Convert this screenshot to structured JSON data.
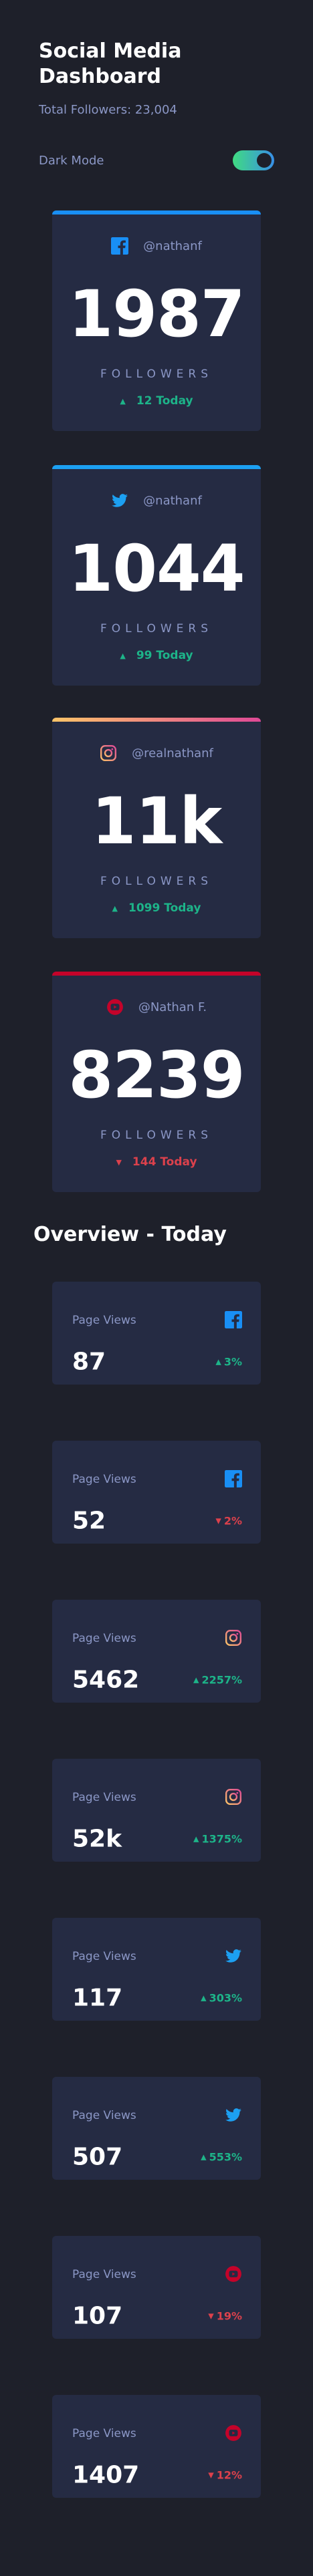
{
  "header": {
    "title": "Social Media Dashboard",
    "total_followers": "Total Followers: 23,004",
    "mode_label": "Dark Mode"
  },
  "colors": {
    "facebook": "#198ff5",
    "twitter": "#1ca0f2",
    "instagram_gradient": [
      "#fdc468",
      "#df4996"
    ],
    "youtube": "#c4032a",
    "up": "#1db489",
    "down": "#dc414c",
    "card_bg": "#252b43",
    "page_bg": "#1e202a",
    "muted_text": "#8b97c6"
  },
  "follower_cards": [
    {
      "platform": "facebook",
      "icon": "facebook-icon",
      "handle": "@nathanf",
      "count": "1987",
      "label": "FOLLOWERS",
      "today": "12 Today",
      "trend": "up"
    },
    {
      "platform": "twitter",
      "icon": "twitter-icon",
      "handle": "@nathanf",
      "count": "1044",
      "label": "FOLLOWERS",
      "today": "99 Today",
      "trend": "up"
    },
    {
      "platform": "instagram",
      "icon": "instagram-icon",
      "handle": "@realnathanf",
      "count": "11k",
      "label": "FOLLOWERS",
      "today": "1099 Today",
      "trend": "up"
    },
    {
      "platform": "youtube",
      "icon": "youtube-icon",
      "handle": "@Nathan F.",
      "count": "8239",
      "label": "FOLLOWERS",
      "today": "144 Today",
      "trend": "down"
    }
  ],
  "overview": {
    "title": "Overview - Today",
    "cards": [
      {
        "label": "Page Views",
        "platform": "facebook",
        "icon": "facebook-icon",
        "value": "87",
        "change": "3%",
        "trend": "up"
      },
      {
        "label": "Page Views",
        "platform": "facebook",
        "icon": "facebook-icon",
        "value": "52",
        "change": "2%",
        "trend": "down"
      },
      {
        "label": "Page Views",
        "platform": "instagram",
        "icon": "instagram-icon",
        "value": "5462",
        "change": "2257%",
        "trend": "up"
      },
      {
        "label": "Page Views",
        "platform": "instagram",
        "icon": "instagram-icon",
        "value": "52k",
        "change": "1375%",
        "trend": "up"
      },
      {
        "label": "Page Views",
        "platform": "twitter",
        "icon": "twitter-icon",
        "value": "117",
        "change": "303%",
        "trend": "up"
      },
      {
        "label": "Page Views",
        "platform": "twitter",
        "icon": "twitter-icon",
        "value": "507",
        "change": "553%",
        "trend": "up"
      },
      {
        "label": "Page Views",
        "platform": "youtube",
        "icon": "youtube-icon",
        "value": "107",
        "change": "19%",
        "trend": "down"
      },
      {
        "label": "Page Views",
        "platform": "youtube",
        "icon": "youtube-icon",
        "value": "1407",
        "change": "12%",
        "trend": "down"
      }
    ]
  }
}
